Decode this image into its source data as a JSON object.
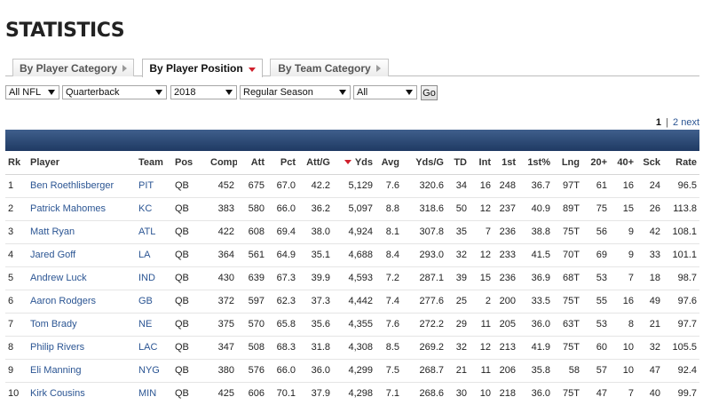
{
  "page": {
    "title": "STATISTICS"
  },
  "tabs": [
    {
      "label": "By Player Category",
      "active": false
    },
    {
      "label": "By Player Position",
      "active": true
    },
    {
      "label": "By Team Category",
      "active": false
    }
  ],
  "filters": {
    "league": "All NFL",
    "position": "Quarterback",
    "season": "2018",
    "season_type": "Regular Season",
    "split": "All",
    "go_label": "Go"
  },
  "pagination": {
    "current": "1",
    "separator": "|",
    "page2": "2",
    "next": "next"
  },
  "table": {
    "columns": [
      "Rk",
      "Player",
      "Team",
      "Pos",
      "Comp",
      "Att",
      "Pct",
      "Att/G",
      "Yds",
      "Avg",
      "Yds/G",
      "TD",
      "Int",
      "1st",
      "1st%",
      "Lng",
      "20+",
      "40+",
      "Sck",
      "Rate"
    ],
    "rows": [
      [
        "1",
        "Ben Roethlisberger",
        "PIT",
        "QB",
        "452",
        "675",
        "67.0",
        "42.2",
        "5,129",
        "7.6",
        "320.6",
        "34",
        "16",
        "248",
        "36.7",
        "97T",
        "61",
        "16",
        "24",
        "96.5"
      ],
      [
        "2",
        "Patrick Mahomes",
        "KC",
        "QB",
        "383",
        "580",
        "66.0",
        "36.2",
        "5,097",
        "8.8",
        "318.6",
        "50",
        "12",
        "237",
        "40.9",
        "89T",
        "75",
        "15",
        "26",
        "113.8"
      ],
      [
        "3",
        "Matt Ryan",
        "ATL",
        "QB",
        "422",
        "608",
        "69.4",
        "38.0",
        "4,924",
        "8.1",
        "307.8",
        "35",
        "7",
        "236",
        "38.8",
        "75T",
        "56",
        "9",
        "42",
        "108.1"
      ],
      [
        "4",
        "Jared Goff",
        "LA",
        "QB",
        "364",
        "561",
        "64.9",
        "35.1",
        "4,688",
        "8.4",
        "293.0",
        "32",
        "12",
        "233",
        "41.5",
        "70T",
        "69",
        "9",
        "33",
        "101.1"
      ],
      [
        "5",
        "Andrew Luck",
        "IND",
        "QB",
        "430",
        "639",
        "67.3",
        "39.9",
        "4,593",
        "7.2",
        "287.1",
        "39",
        "15",
        "236",
        "36.9",
        "68T",
        "53",
        "7",
        "18",
        "98.7"
      ],
      [
        "6",
        "Aaron Rodgers",
        "GB",
        "QB",
        "372",
        "597",
        "62.3",
        "37.3",
        "4,442",
        "7.4",
        "277.6",
        "25",
        "2",
        "200",
        "33.5",
        "75T",
        "55",
        "16",
        "49",
        "97.6"
      ],
      [
        "7",
        "Tom Brady",
        "NE",
        "QB",
        "375",
        "570",
        "65.8",
        "35.6",
        "4,355",
        "7.6",
        "272.2",
        "29",
        "11",
        "205",
        "36.0",
        "63T",
        "53",
        "8",
        "21",
        "97.7"
      ],
      [
        "8",
        "Philip Rivers",
        "LAC",
        "QB",
        "347",
        "508",
        "68.3",
        "31.8",
        "4,308",
        "8.5",
        "269.2",
        "32",
        "12",
        "213",
        "41.9",
        "75T",
        "60",
        "10",
        "32",
        "105.5"
      ],
      [
        "9",
        "Eli Manning",
        "NYG",
        "QB",
        "380",
        "576",
        "66.0",
        "36.0",
        "4,299",
        "7.5",
        "268.7",
        "21",
        "11",
        "206",
        "35.8",
        "58",
        "57",
        "10",
        "47",
        "92.4"
      ],
      [
        "10",
        "Kirk Cousins",
        "MIN",
        "QB",
        "425",
        "606",
        "70.1",
        "37.9",
        "4,298",
        "7.1",
        "268.6",
        "30",
        "10",
        "218",
        "36.0",
        "75T",
        "47",
        "7",
        "40",
        "99.7"
      ]
    ]
  },
  "colors": {
    "header_bar": "#2a4770",
    "link": "#2b5593",
    "sort_arrow": "#d0202c"
  }
}
